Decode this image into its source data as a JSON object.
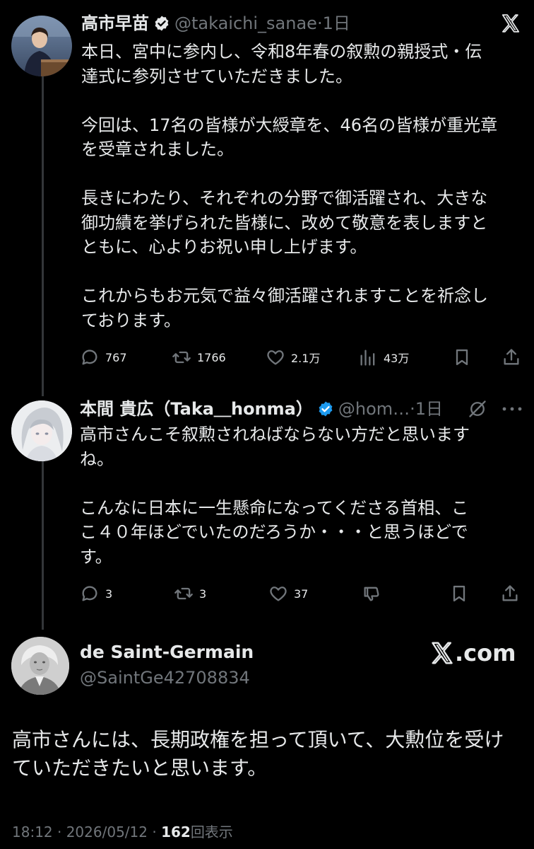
{
  "post1": {
    "name": "高市早苗",
    "handle": "@takaichi_sanae",
    "sep": "·",
    "time": "1日",
    "paragraphs": [
      [
        "本日、宮中に参内し、令和8年春の叙勲の親授式・伝",
        "達式に参列させていただきました。"
      ],
      [
        "今回は、17名の皆様が大綬章を、46名の皆様が重光章",
        "を受章されました。"
      ],
      [
        "長きにわたり、それぞれの分野で御活躍され、大きな",
        "御功績を挙げられた皆様に、改めて敬意を表しますと",
        "ともに、心よりお祝い申し上げます。"
      ],
      [
        "これからもお元気で益々御活躍されますことを祈念し",
        "ております。"
      ]
    ],
    "replies": "767",
    "reposts": "1766",
    "likes": "2.1万",
    "views": "43万"
  },
  "post2": {
    "name": "本間 貴広（Taka＿honma）",
    "handle": "@hom…",
    "sep": "·",
    "time": "1日",
    "paragraphs": [
      [
        "高市さんこそ叙勲されねばならない方だと思います",
        "ね。"
      ],
      [
        "こんなに日本に一生懸命になってくださる首相、こ",
        "こ４０年ほどでいたのだろうか・・・と思うほどで",
        "す。"
      ]
    ],
    "replies": "3",
    "reposts": "3",
    "likes": "37"
  },
  "quote": {
    "name": "de Saint-Germain",
    "handle": "@SaintGe42708834",
    "site": ".com",
    "text": [
      "高市さんには、長期政権を担って頂いて、大勲位を受け",
      "ていただきたいと思います。"
    ],
    "footer_time": "18:12 · 2026/05/12 · ",
    "footer_views": "162",
    "footer_views_label": "回表示"
  },
  "colors": {
    "background": "#000000",
    "text": "#e7e9ea",
    "muted": "#71767b",
    "verified": "#1d9bf0"
  },
  "icons": [
    "x-logo-icon",
    "verified-badge-icon",
    "reply-icon",
    "repost-icon",
    "like-icon",
    "views-icon",
    "bookmark-icon",
    "share-icon",
    "grok-icon",
    "more-icon",
    "dislike-icon"
  ]
}
